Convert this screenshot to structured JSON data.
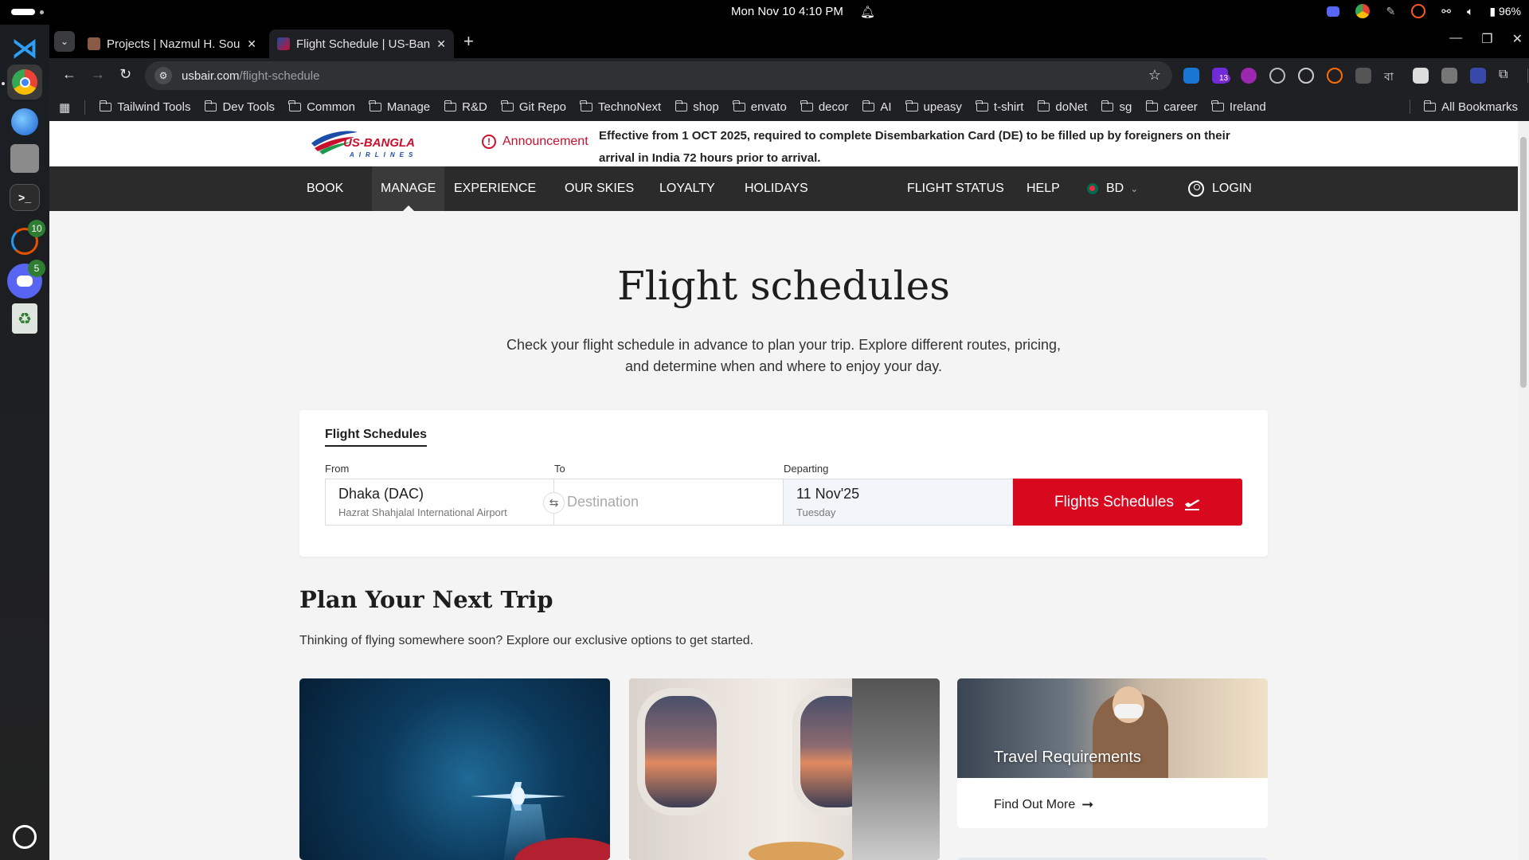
{
  "system": {
    "clock": "Mon Nov 10   4:10 PM",
    "battery": "96%"
  },
  "dock": {
    "badges": {
      "timer": "10",
      "discord": "5"
    }
  },
  "browser": {
    "tabs": [
      {
        "label": "Projects | Nazmul H. Sour",
        "active": false
      },
      {
        "label": "Flight Schedule | US-Bangla",
        "active": true
      }
    ],
    "url_host": "usbair.com",
    "url_path": "/flight-schedule",
    "extension_badge": "13",
    "bookmarks": [
      "Tailwind Tools",
      "Dev Tools",
      "Common",
      "Manage",
      "R&D",
      "Git Repo",
      "TechnoNext",
      "shop",
      "envato",
      "decor",
      "AI",
      "upeasy",
      "t-shirt",
      "doNet",
      "sg",
      "career",
      "Ireland"
    ],
    "all_bookmarks": "All Bookmarks"
  },
  "site": {
    "announcement_label": "Announcement",
    "announcement_text": "Effective from 1 OCT 2025, required to complete Disembarkation Card (DE) to be filled up by foreigners on their arrival in India 72 hours prior to arrival.",
    "nav": {
      "book": "BOOK",
      "manage": "MANAGE",
      "experience": "EXPERIENCE",
      "our_skies": "OUR SKIES",
      "loyalty": "LOYALTY",
      "holidays": "HOLIDAYS",
      "flight_status": "FLIGHT STATUS",
      "help": "HELP",
      "country": "BD",
      "login": "LOGIN"
    }
  },
  "hero": {
    "title": "Flight schedules",
    "subtitle": "Check your flight schedule in advance to plan your trip. Explore different routes, pricing, and determine when and where to enjoy your day."
  },
  "search": {
    "tab": "Flight Schedules",
    "from_label": "From",
    "to_label": "To",
    "departing_label": "Departing",
    "from_value": "Dhaka (DAC)",
    "from_airport": "Hazrat Shahjalal International Airport",
    "to_placeholder": "Destination",
    "date_value": "11 Nov'25",
    "date_day": "Tuesday",
    "button": "Flights Schedules"
  },
  "plan": {
    "title": "Plan Your Next Trip",
    "subtitle": "Thinking of flying somewhere soon? Explore our exclusive options to get started.",
    "card3_title": "Travel Requirements",
    "card3_link": "Find Out More"
  },
  "colors": {
    "brand_red": "#d8081e",
    "nav_bg": "#2b2b2b",
    "page_bg": "#f4f4f4"
  }
}
